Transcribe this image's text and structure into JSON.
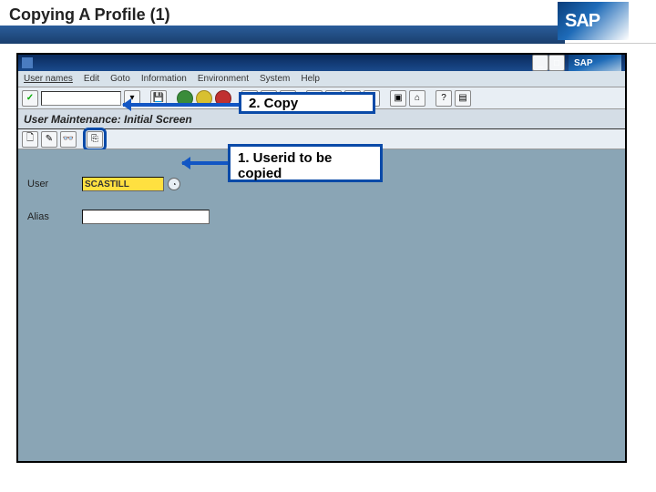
{
  "slide": {
    "title": "Copying A Profile (1)",
    "logo_text": "SAP"
  },
  "window": {
    "mini_logo": "SAP"
  },
  "menu": {
    "items": [
      "User names",
      "Edit",
      "Goto",
      "Information",
      "Environment",
      "System",
      "Help"
    ]
  },
  "screen": {
    "title": "User Maintenance: Initial Screen"
  },
  "fields": {
    "user_label": "User",
    "user_value": "SCASTILL",
    "alias_label": "Alias",
    "alias_value": ""
  },
  "callouts": {
    "copy": "2.  Copy",
    "userid": "1. Userid to be copied"
  },
  "icons": {
    "check": "✓",
    "back": "◀",
    "save": "💾",
    "print": "🖨",
    "find": "🔍",
    "help": "?",
    "create": "🗋",
    "change": "✎",
    "display": "👓",
    "copy": "⎘",
    "f4": "◔"
  }
}
